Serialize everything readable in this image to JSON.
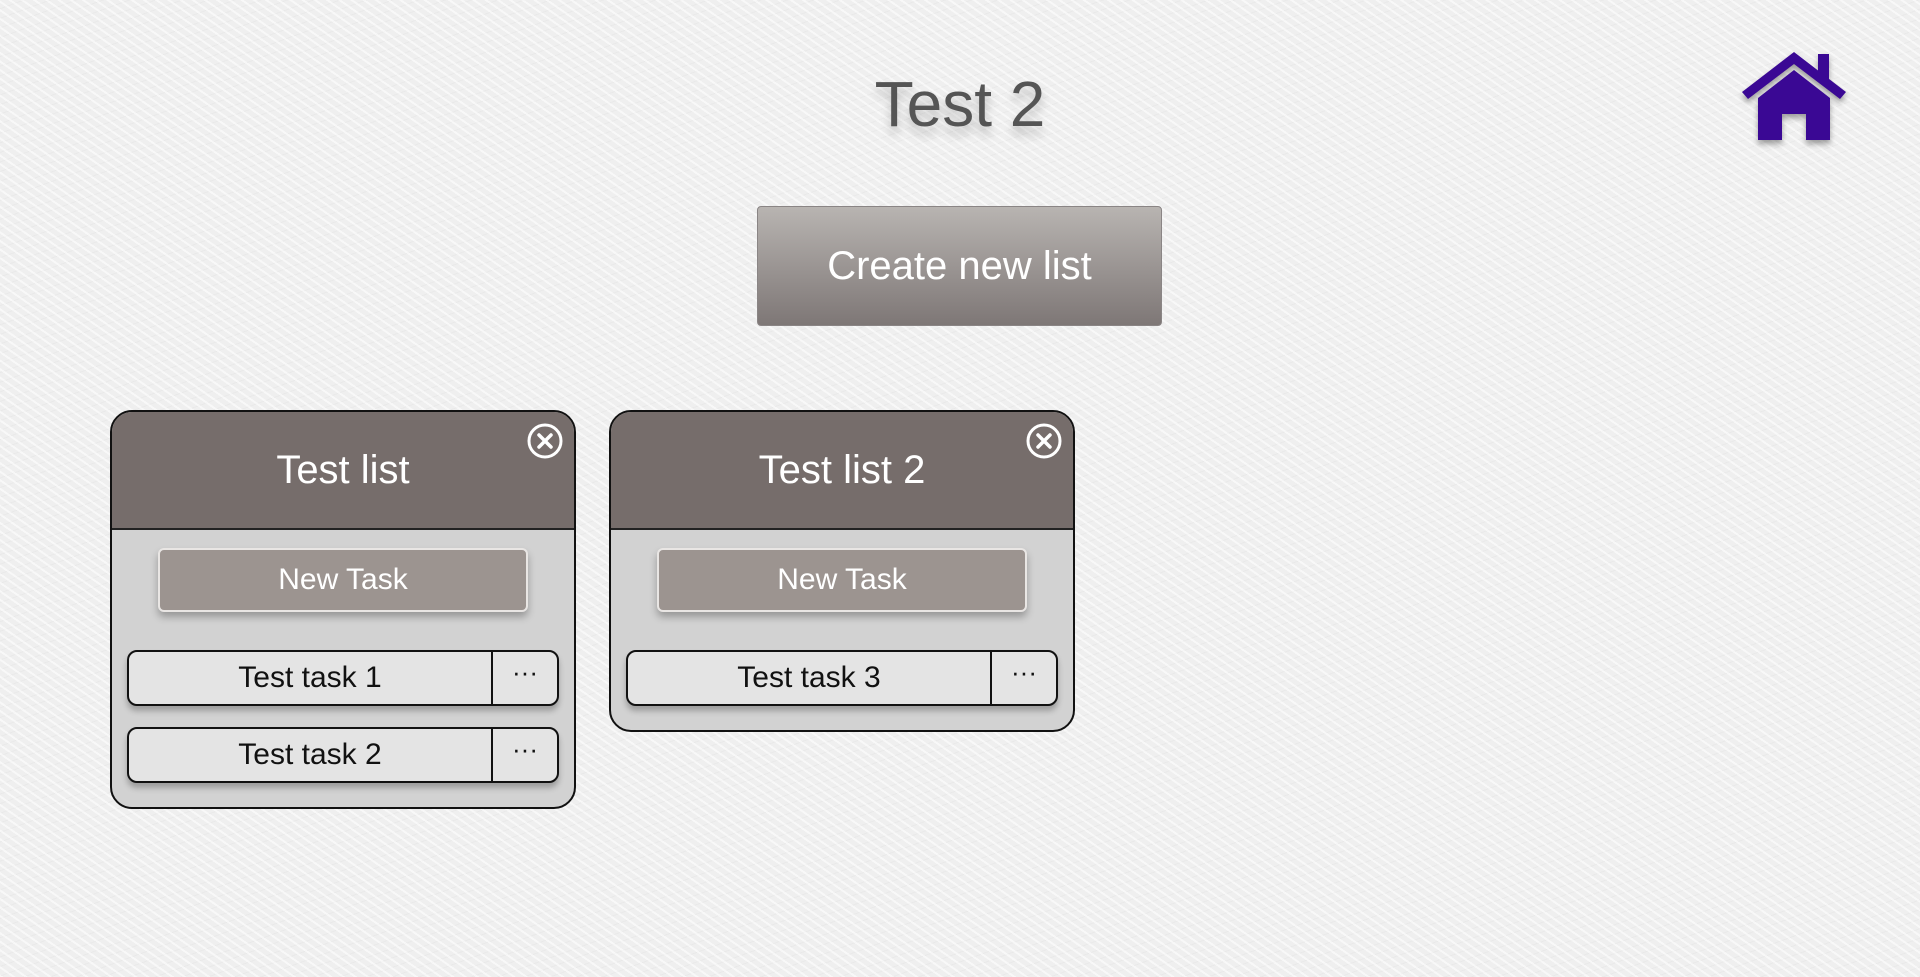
{
  "page": {
    "title": "Test 2"
  },
  "header": {
    "home_icon": "home-icon",
    "home_icon_color": "#3a0894"
  },
  "toolbar": {
    "create_list_label": "Create new list"
  },
  "lists": [
    {
      "title": "Test list",
      "close_icon": "circle-x-icon",
      "new_task_label": "New Task",
      "tasks": [
        {
          "name": "Test task 1",
          "menu_label": "···"
        },
        {
          "name": "Test task 2",
          "menu_label": "···"
        }
      ]
    },
    {
      "title": "Test list 2",
      "close_icon": "circle-x-icon",
      "new_task_label": "New Task",
      "tasks": [
        {
          "name": "Test task 3",
          "menu_label": "···"
        }
      ]
    }
  ],
  "colors": {
    "list_header": "#766d6b",
    "list_body": "#d2d2d2",
    "task_bg": "#e4e4e4",
    "new_task_button": "#9c9490",
    "title_text": "#555555"
  }
}
